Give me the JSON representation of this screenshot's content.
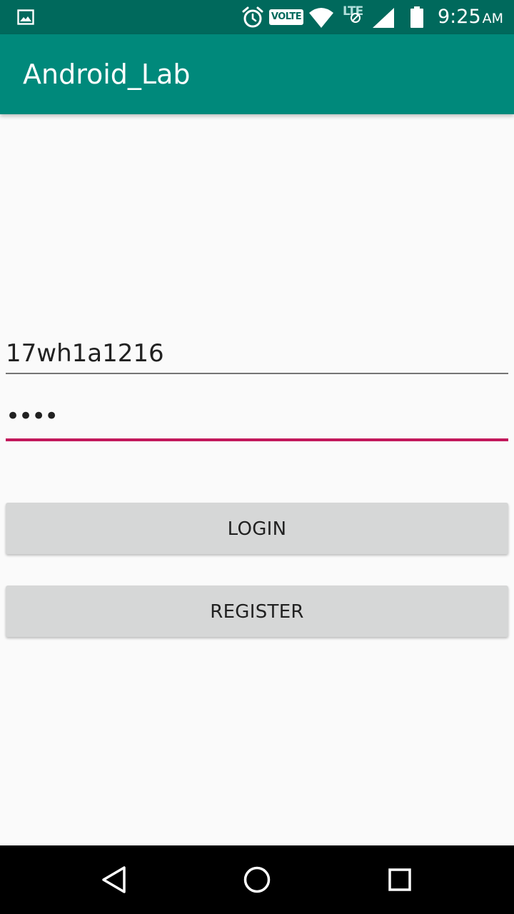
{
  "status_bar": {
    "left_icons": [
      "gallery-icon"
    ],
    "right_icons": [
      "alarm-icon",
      "volte-badge",
      "wifi-icon",
      "lte-icon",
      "signal-icon",
      "battery-icon"
    ],
    "volte_label": "VOLTE",
    "lte_label": "LTE",
    "time": "9:25",
    "ampm": "AM"
  },
  "app_bar": {
    "title": "Android_Lab"
  },
  "form": {
    "username_value": "17wh1a1216",
    "password_masked": "••••",
    "focused_field": "password",
    "accent_color": "#c2185b"
  },
  "buttons": {
    "login_label": "LOGIN",
    "register_label": "REGISTER"
  },
  "nav_bar": {
    "items": [
      "back-icon",
      "home-icon",
      "recents-icon"
    ]
  },
  "colors": {
    "status_bar": "#00695c",
    "app_bar": "#00897b",
    "background": "#fafafa",
    "button": "#d6d7d7"
  }
}
